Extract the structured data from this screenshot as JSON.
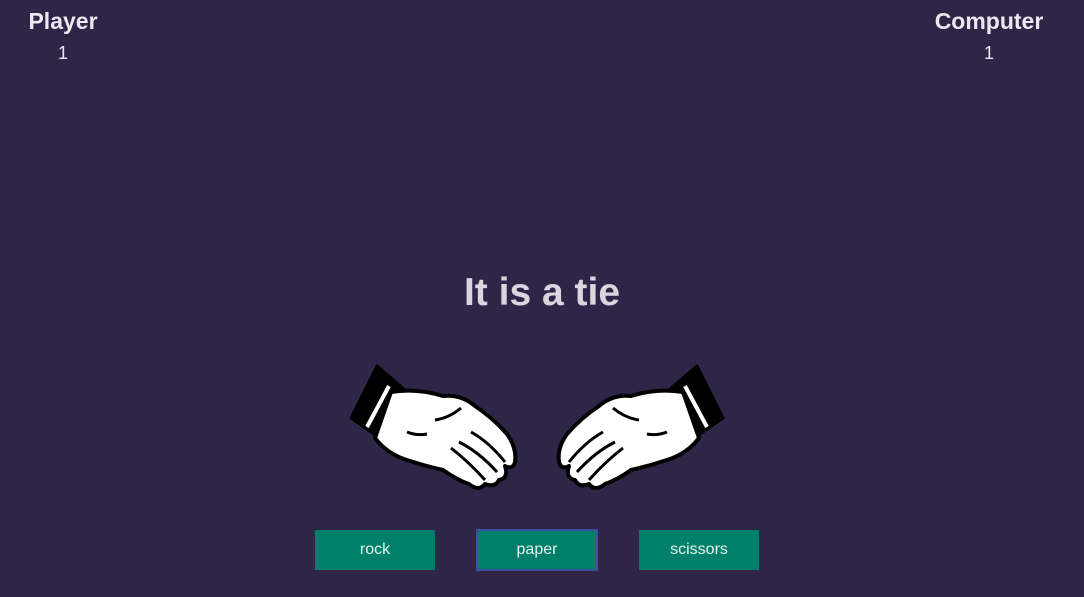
{
  "scoreboard": {
    "player_label": "Player",
    "player_score": "1",
    "computer_label": "Computer",
    "computer_score": "1"
  },
  "result": {
    "message": "It is a tie"
  },
  "hands": {
    "player_choice_icon": "paper-hand-icon",
    "computer_choice_icon": "paper-hand-icon"
  },
  "controls": {
    "rock_label": "rock",
    "paper_label": "paper",
    "scissors_label": "scissors"
  },
  "colors": {
    "background": "#2f2547",
    "button": "#00806a",
    "button_focus_border": "#3f4fa0"
  }
}
